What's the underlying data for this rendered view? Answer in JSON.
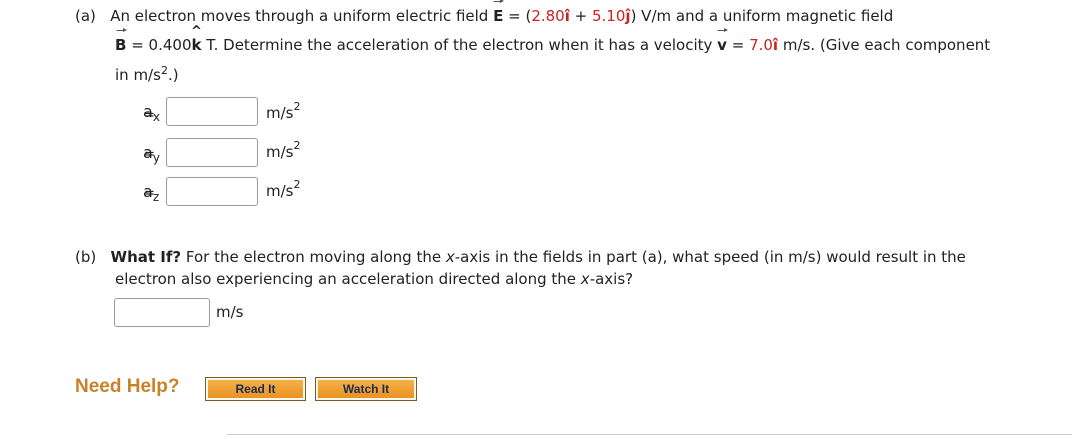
{
  "part_a": {
    "label": "(a)",
    "line1_pre": "An electron moves through a uniform electric field ",
    "E_symbol": "E",
    "line1_eq": " = ",
    "line1_paren_open": "(",
    "E_x": "2.80",
    "i_hat": "î",
    "plus": " + ",
    "E_y": "5.10",
    "j_hat": "ĵ",
    "line1_post": ") V/m and a uniform magnetic field",
    "B_symbol": "B",
    "line2_eq": " = 0.400",
    "k_hat": "k",
    "line2_mid": " T. Determine the acceleration of the electron when it has a velocity ",
    "v_symbol": "v",
    "line2_eq2": " = ",
    "v_val": "7.0",
    "v_unit_vec": "î",
    "line2_post": " m/s. (Give each component",
    "line3": "in m/s",
    "line3_sup": "2",
    "line3_end": ".)",
    "rows": [
      {
        "var": "a",
        "sub": "x",
        "eq": "=",
        "unit": "m/s",
        "unit_sup": "2",
        "value": ""
      },
      {
        "var": "a",
        "sub": "y",
        "eq": "=",
        "unit": "m/s",
        "unit_sup": "2",
        "value": ""
      },
      {
        "var": "a",
        "sub": "z",
        "eq": "=",
        "unit": "m/s",
        "unit_sup": "2",
        "value": ""
      }
    ]
  },
  "part_b": {
    "label": "(b)",
    "whatif": "What If?",
    "line1_rest_pre": " For the electron moving along the ",
    "x_axis": "x",
    "line1_rest_post": "-axis in the fields in part (a), what speed (in m/s) would result in the",
    "line2_pre": "electron also experiencing an acceleration directed along the ",
    "line2_x": "x",
    "line2_post": "-axis?",
    "unit": "m/s",
    "value": ""
  },
  "help": {
    "label": "Need Help?",
    "read_it": "Read It",
    "watch_it": "Watch It"
  },
  "colors": {
    "given_value": "#cc2222",
    "help_text": "#c9822a",
    "button": "#f0a030"
  }
}
